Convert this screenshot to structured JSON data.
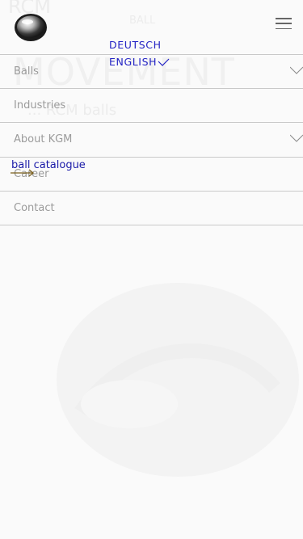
{
  "hero": {
    "word_top": "RCM",
    "caption": "BALL",
    "word": "MOVEMENT",
    "subtitle": "... RCM balls"
  },
  "icons": {
    "logo": "kgm-ball-logo",
    "menu": "hamburger-icon",
    "check": "checkmark-icon",
    "chevron": "chevron-down-icon",
    "arrow": "arrow-right-icon"
  },
  "colors": {
    "accent": "#2323c4",
    "menu_text": "#9b9b9b",
    "divider": "#c9c9c9",
    "arrow": "#7a5f1c"
  },
  "language": {
    "options": [
      "DEUTSCH",
      "ENGLISH"
    ],
    "selected": "ENGLISH"
  },
  "menu": {
    "items": [
      {
        "label": "Balls",
        "has_submenu": true
      },
      {
        "label": "Industries",
        "has_submenu": false
      },
      {
        "label": "About KGM",
        "has_submenu": true
      },
      {
        "label": "Career",
        "has_submenu": false
      },
      {
        "label": "Contact",
        "has_submenu": false
      }
    ]
  },
  "catalogue": {
    "label": "ball catalogue"
  }
}
